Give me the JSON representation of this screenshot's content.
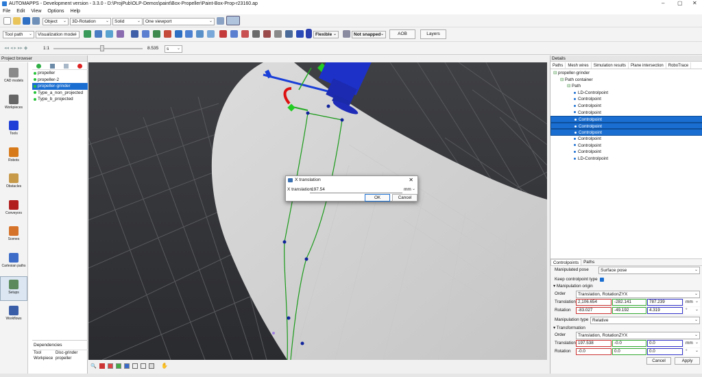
{
  "app": {
    "title": "AUTOMAPPS - Development version - 3.3.0 - D:\\ProjPub\\OLP-Demos\\paint\\Box-Propeller\\Paint-Box-Prop-r23160.ap"
  },
  "window_controls": {
    "minimize": "–",
    "maximize": "▢",
    "close": "✕"
  },
  "menu": [
    "File",
    "Edit",
    "View",
    "Options",
    "Help"
  ],
  "toolbar1": {
    "mode": "Object",
    "manipulator": "3D-Rotation",
    "render": "Solid",
    "viewport": "One viewport"
  },
  "toolbar2": {
    "object_type": "Tool path",
    "model": "Visualization model",
    "flexible": "Flexible",
    "snap": "Not snapped",
    "aob": "AOB",
    "layers": "Layers"
  },
  "toolbar3": {
    "ratio": "1:1",
    "value": "8.535",
    "unit": "s"
  },
  "project_browser": {
    "title": "Project browser",
    "categories": [
      {
        "label": "CAD models",
        "icon": "cad-model-icon",
        "color": "#8a8a8a"
      },
      {
        "label": "Workpieces",
        "icon": "workpiece-icon",
        "color": "#666666"
      },
      {
        "label": "Tools",
        "icon": "tool-icon",
        "color": "#1f3fd6"
      },
      {
        "label": "Robots",
        "icon": "robot-icon",
        "color": "#d77a1a"
      },
      {
        "label": "Obstacles",
        "icon": "obstacle-icon",
        "color": "#c79a4a"
      },
      {
        "label": "Conveyors",
        "icon": "conveyor-icon",
        "color": "#b21f1f"
      },
      {
        "label": "Scenes",
        "icon": "scene-icon",
        "color": "#d6732a"
      },
      {
        "label": "Cartesian paths",
        "icon": "cartesian-path-icon",
        "color": "#3c6bc8"
      },
      {
        "label": "Setups",
        "icon": "setup-icon",
        "color": "#5c8a5c"
      },
      {
        "label": "Workflows",
        "icon": "workflow-icon",
        "color": "#3b5ea8"
      }
    ],
    "items": [
      "propeller",
      "propeller-2",
      "propeller-grinder",
      "Type_a_non_projected",
      "Type_b_projected"
    ],
    "selected_index": 2,
    "dependencies": {
      "title": "Dependencies",
      "rows": [
        {
          "key": "Tool",
          "value": "Disc-grinder"
        },
        {
          "key": "Workpiece",
          "value": "propeller"
        }
      ]
    }
  },
  "dialog": {
    "title": "X translation",
    "label": "X translation",
    "value": "197.54",
    "unit": "mm",
    "ok": "OK",
    "cancel": "Cancel"
  },
  "details": {
    "title": "Details",
    "tabs": [
      "Paths",
      "Mesh wires",
      "Simulation results",
      "Plane intersection",
      "RoboTrace"
    ],
    "tree": [
      {
        "label": "propeller-grinder",
        "level": 0,
        "selected": false
      },
      {
        "label": "Path container",
        "level": 1,
        "selected": false
      },
      {
        "label": "Path",
        "level": 2,
        "selected": false
      },
      {
        "label": "LD-Controlpoint",
        "level": 3,
        "selected": false
      },
      {
        "label": "Controlpoint",
        "level": 3,
        "selected": false
      },
      {
        "label": "Controlpoint",
        "level": 3,
        "selected": false
      },
      {
        "label": "Controlpoint",
        "level": 3,
        "selected": false
      },
      {
        "label": "Controlpoint",
        "level": 3,
        "selected": true
      },
      {
        "label": "Controlpoint",
        "level": 3,
        "selected": true
      },
      {
        "label": "Controlpoint",
        "level": 3,
        "selected": true
      },
      {
        "label": "Controlpoint",
        "level": 3,
        "selected": false
      },
      {
        "label": "Controlpoint",
        "level": 3,
        "selected": false
      },
      {
        "label": "Controlpoint",
        "level": 3,
        "selected": false
      },
      {
        "label": "LD-Controlpoint",
        "level": 3,
        "selected": false
      }
    ],
    "props": {
      "tabs": [
        "Controlpoints",
        "Paths"
      ],
      "manipulated_pose_label": "Manipulated pose",
      "manipulated_pose": "Surface pose",
      "keep_type_label": "Keep controlpoint type",
      "origin_header": "Manipulation origin",
      "order_label": "Order",
      "order": "Translation, RotationZYX",
      "translation_label": "Translation",
      "translation": [
        "2,106.654",
        "-282.141",
        "787.239"
      ],
      "translation_unit": "mm",
      "rotation_label": "Rotation",
      "rotation": [
        "-83.027",
        "-49.192",
        "4.319"
      ],
      "rotation_unit": "°",
      "manip_type_label": "Manipulation type",
      "manip_type": "Relative",
      "transform_header": "Transformation",
      "t_order": "Translation, RotationZYX",
      "t_translation": [
        "197.538",
        "-0.0",
        "0.0"
      ],
      "t_rotation": [
        "-0.0",
        "0.0",
        "0.0"
      ],
      "cancel": "Cancel",
      "apply": "Apply"
    }
  }
}
